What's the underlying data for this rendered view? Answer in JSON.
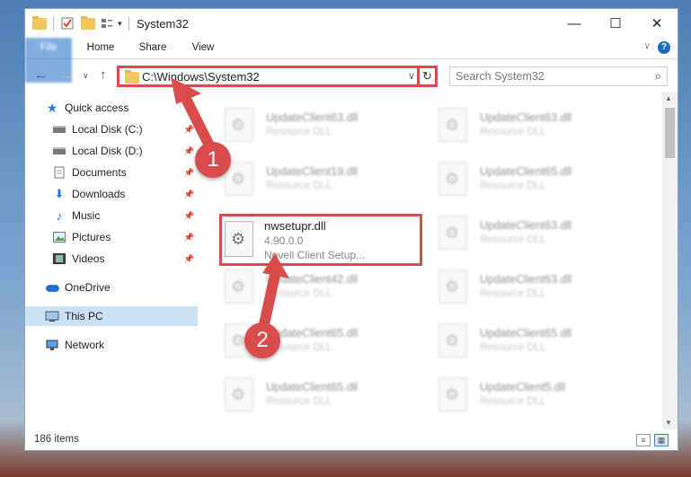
{
  "window": {
    "title": "System32"
  },
  "ribbon": {
    "tabs": [
      "File",
      "Home",
      "Share",
      "View"
    ]
  },
  "nav": {
    "address": "C:\\Windows\\System32",
    "search_placeholder": "Search System32"
  },
  "sidebar": {
    "items": [
      {
        "label": "Quick access",
        "icon": "star-icon"
      },
      {
        "label": "Local Disk (C:)",
        "icon": "drive-icon"
      },
      {
        "label": "Local Disk (D:)",
        "icon": "drive-icon"
      },
      {
        "label": "Documents",
        "icon": "documents-icon"
      },
      {
        "label": "Downloads",
        "icon": "downloads-icon"
      },
      {
        "label": "Music",
        "icon": "music-icon"
      },
      {
        "label": "Pictures",
        "icon": "pictures-icon"
      },
      {
        "label": "Videos",
        "icon": "videos-icon"
      },
      {
        "label": "OneDrive",
        "icon": "cloud-icon"
      },
      {
        "label": "This PC",
        "icon": "computer-icon"
      },
      {
        "label": "Network",
        "icon": "network-icon"
      }
    ]
  },
  "files": [
    {
      "name": "UpdateClient63.dll",
      "desc": "Resource DLL"
    },
    {
      "name": "UpdateClient63.dll",
      "desc": "Resource DLL"
    },
    {
      "name": "UpdateClient19.dll",
      "desc": "Resource DLL"
    },
    {
      "name": "UpdateClient65.dll",
      "desc": "Resource DLL"
    },
    {
      "name": "UpdateClient63.dll",
      "desc": "Resource DLL"
    },
    {
      "name": "UpdateClient42.dll",
      "desc": "Resource DLL"
    },
    {
      "name": "UpdateClient63.dll",
      "desc": "Resource DLL"
    },
    {
      "name": "UpdateClient65.dll",
      "desc": "Resource DLL"
    },
    {
      "name": "UpdateClient65.dll",
      "desc": "Resource DLL"
    },
    {
      "name": "UpdateClient65.dll",
      "desc": "Resource DLL"
    },
    {
      "name": "UpdateClient5.dll",
      "desc": "Resource DLL"
    }
  ],
  "highlighted_file": {
    "name": "nwsetupr.dll",
    "version": "4.90.0.0",
    "desc": "Novell Client Setup..."
  },
  "status": {
    "item_count": "186 items"
  },
  "annotations": {
    "step1": "1",
    "step2": "2"
  },
  "colors": {
    "accent": "#1a6dc6",
    "highlight": "#d84c4c",
    "selection": "#cce0f3"
  }
}
